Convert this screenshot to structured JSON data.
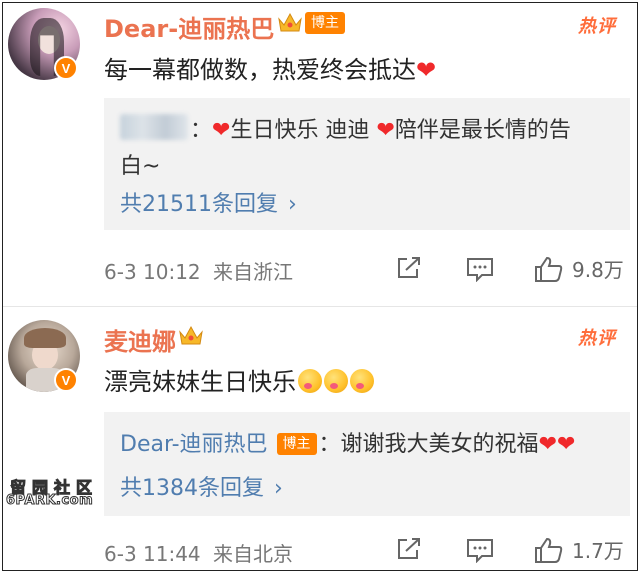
{
  "comments": [
    {
      "author": "Dear-迪丽热巴",
      "author_tag": "博主",
      "hot_label": "热评",
      "text": "每一幕都做数，热爱终会抵达",
      "reply": {
        "line1_a": "：",
        "line1_b": "生日快乐 迪迪 ",
        "line1_c": "陪伴是最长情的告",
        "line2": "白~",
        "more": "共21511条回复"
      },
      "time": "6-3 10:12",
      "source": "来自浙江",
      "like_count": "9.8万"
    },
    {
      "author": "麦迪娜",
      "hot_label": "热评",
      "text": "漂亮妹妹生日快乐",
      "reply": {
        "author": "Dear-迪丽热巴",
        "author_tag": "博主",
        "text": "：谢谢我大美女的祝福",
        "more": "共1384条回复"
      },
      "time": "6-3 11:44",
      "source": "来自北京",
      "like_count": "1.7万"
    }
  ],
  "icons": {
    "heart": "red-heart-icon",
    "chevron": "chevron-right-icon",
    "share": "share-icon",
    "comment": "comment-icon",
    "like": "thumbs-up-icon",
    "verified": "verified-v-icon",
    "crown": "crown-icon",
    "emoji": "kiss-emoji-icon"
  },
  "watermark": {
    "line1": "留园社区",
    "line2": "6PARK.com"
  },
  "colors": {
    "author": "#eb7350",
    "link": "#507daf",
    "tag": "#ff8200",
    "heart": "#f0292b",
    "hot": "#ff6d3b"
  }
}
